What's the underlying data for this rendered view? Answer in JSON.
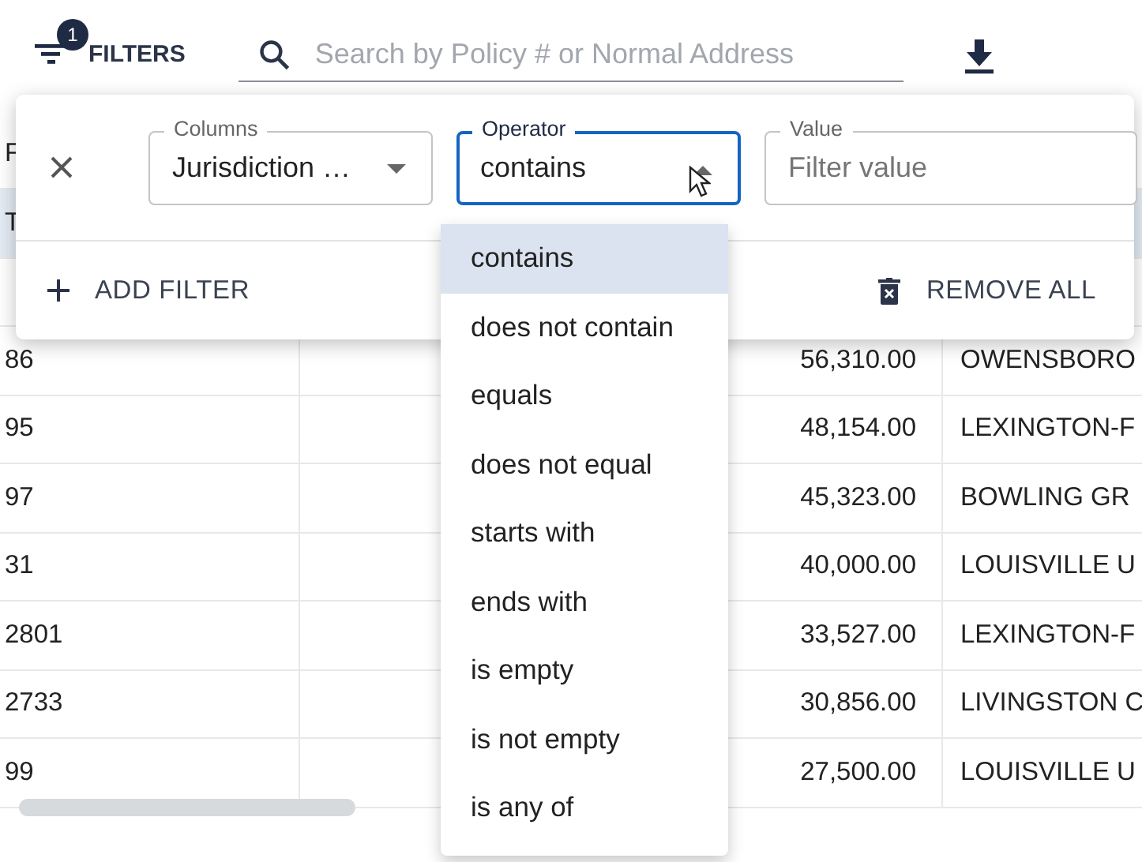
{
  "toolbar": {
    "filters_button": {
      "label": "FILTERS",
      "badge": "1"
    },
    "search": {
      "placeholder": "Search by Policy # or Normal Address"
    }
  },
  "table": {
    "header": {
      "column_1": "F"
    },
    "rows": [
      {
        "column_1": "T",
        "selected": true
      },
      {
        "selected": false
      },
      {
        "column_1": "86",
        "column_3": "56,310.00",
        "column_4": "OWENSBORO",
        "selected": false
      },
      {
        "column_1": "95",
        "column_3": "48,154.00",
        "column_4": "LEXINGTON-F",
        "selected": false
      },
      {
        "column_1": "97",
        "column_3": "45,323.00",
        "column_4": "BOWLING GR",
        "selected": false
      },
      {
        "column_1": "31",
        "column_3": "40,000.00",
        "column_4": "LOUISVILLE U",
        "selected": false
      },
      {
        "column_1": "2801",
        "column_3": "33,527.00",
        "column_4": "LEXINGTON-F",
        "selected": false
      },
      {
        "column_1": "2733",
        "column_3": "30,856.00",
        "column_4": "LIVINGSTON C",
        "selected": false
      },
      {
        "column_1": "99",
        "column_3": "27,500.00",
        "column_4": "LOUISVILLE U",
        "selected": false
      }
    ]
  },
  "filter_panel": {
    "filters": [
      {
        "column": {
          "label": "Columns",
          "value": "Jurisdiction …"
        },
        "operator": {
          "label": "Operator",
          "value": "contains",
          "focused": true,
          "expanded": true
        },
        "value": {
          "label": "Value",
          "placeholder": "Filter value"
        }
      }
    ],
    "add_button": "ADD FILTER",
    "remove_all_button": "REMOVE ALL"
  },
  "operator_menu": {
    "options": [
      {
        "label": "contains",
        "selected": true
      },
      {
        "label": "does not contain",
        "selected": false
      },
      {
        "label": "equals",
        "selected": false
      },
      {
        "label": "does not equal",
        "selected": false
      },
      {
        "label": "starts with",
        "selected": false
      },
      {
        "label": "ends with",
        "selected": false
      },
      {
        "label": "is empty",
        "selected": false
      },
      {
        "label": "is not empty",
        "selected": false
      },
      {
        "label": "is any of",
        "selected": false
      }
    ]
  }
}
